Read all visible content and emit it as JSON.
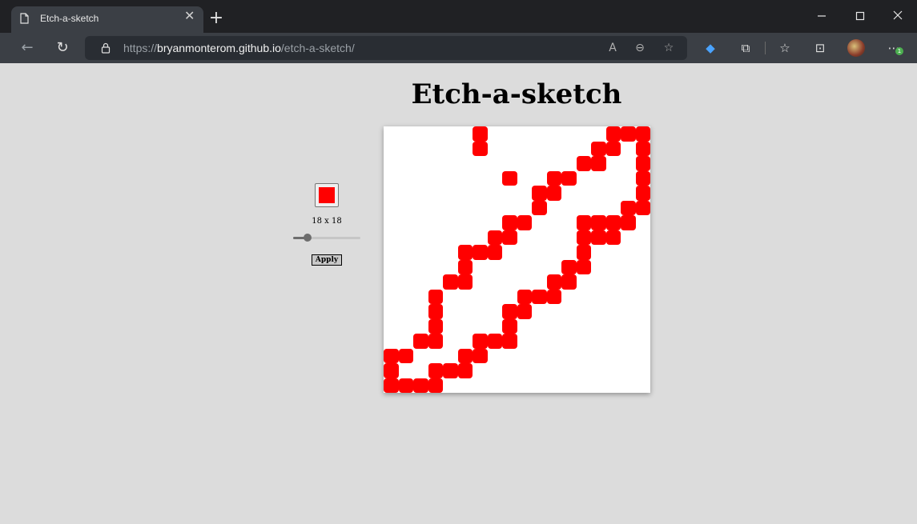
{
  "browser": {
    "tab_title": "Etch-a-sketch",
    "new_tab_label": "+",
    "url_scheme": "https://",
    "url_host": "bryanmonterom.github.io",
    "url_path": "/etch-a-sketch/",
    "window_controls": [
      "minimize",
      "maximize",
      "close"
    ],
    "toolbar_icons": [
      "read-aloud-icon",
      "zoom-out-icon",
      "add-favorite-icon",
      "extension-diamond-icon",
      "extensions-icon",
      "favorites-icon",
      "collections-icon",
      "profile-avatar",
      "more-menu-icon"
    ],
    "notification_badge": "1"
  },
  "page": {
    "title": "Etch-a-sketch",
    "color_value": "#ff0000",
    "size_label": "18 x 18",
    "slider_value": 18,
    "slider_max": 100,
    "slider_min": 0,
    "apply_label": "Apply"
  },
  "grid": {
    "size": 18,
    "paint_color": "#ff0000",
    "filled_cells": [
      [
        0,
        6
      ],
      [
        0,
        15
      ],
      [
        0,
        16
      ],
      [
        0,
        17
      ],
      [
        1,
        6
      ],
      [
        1,
        14
      ],
      [
        1,
        15
      ],
      [
        1,
        17
      ],
      [
        2,
        13
      ],
      [
        2,
        14
      ],
      [
        2,
        17
      ],
      [
        3,
        8
      ],
      [
        3,
        11
      ],
      [
        3,
        12
      ],
      [
        3,
        17
      ],
      [
        4,
        10
      ],
      [
        4,
        11
      ],
      [
        4,
        17
      ],
      [
        5,
        10
      ],
      [
        5,
        16
      ],
      [
        5,
        17
      ],
      [
        6,
        8
      ],
      [
        6,
        9
      ],
      [
        6,
        13
      ],
      [
        6,
        14
      ],
      [
        6,
        15
      ],
      [
        6,
        16
      ],
      [
        7,
        7
      ],
      [
        7,
        8
      ],
      [
        7,
        13
      ],
      [
        7,
        14
      ],
      [
        7,
        15
      ],
      [
        8,
        5
      ],
      [
        8,
        6
      ],
      [
        8,
        7
      ],
      [
        8,
        13
      ],
      [
        9,
        5
      ],
      [
        9,
        12
      ],
      [
        9,
        13
      ],
      [
        10,
        4
      ],
      [
        10,
        5
      ],
      [
        10,
        11
      ],
      [
        10,
        12
      ],
      [
        11,
        3
      ],
      [
        11,
        9
      ],
      [
        11,
        10
      ],
      [
        11,
        11
      ],
      [
        12,
        3
      ],
      [
        12,
        8
      ],
      [
        12,
        9
      ],
      [
        13,
        3
      ],
      [
        13,
        8
      ],
      [
        14,
        2
      ],
      [
        14,
        3
      ],
      [
        14,
        6
      ],
      [
        14,
        7
      ],
      [
        14,
        8
      ],
      [
        15,
        0
      ],
      [
        15,
        1
      ],
      [
        15,
        5
      ],
      [
        15,
        6
      ],
      [
        16,
        0
      ],
      [
        16,
        3
      ],
      [
        16,
        4
      ],
      [
        16,
        5
      ],
      [
        17,
        0
      ],
      [
        17,
        1
      ],
      [
        17,
        2
      ],
      [
        17,
        3
      ]
    ]
  }
}
